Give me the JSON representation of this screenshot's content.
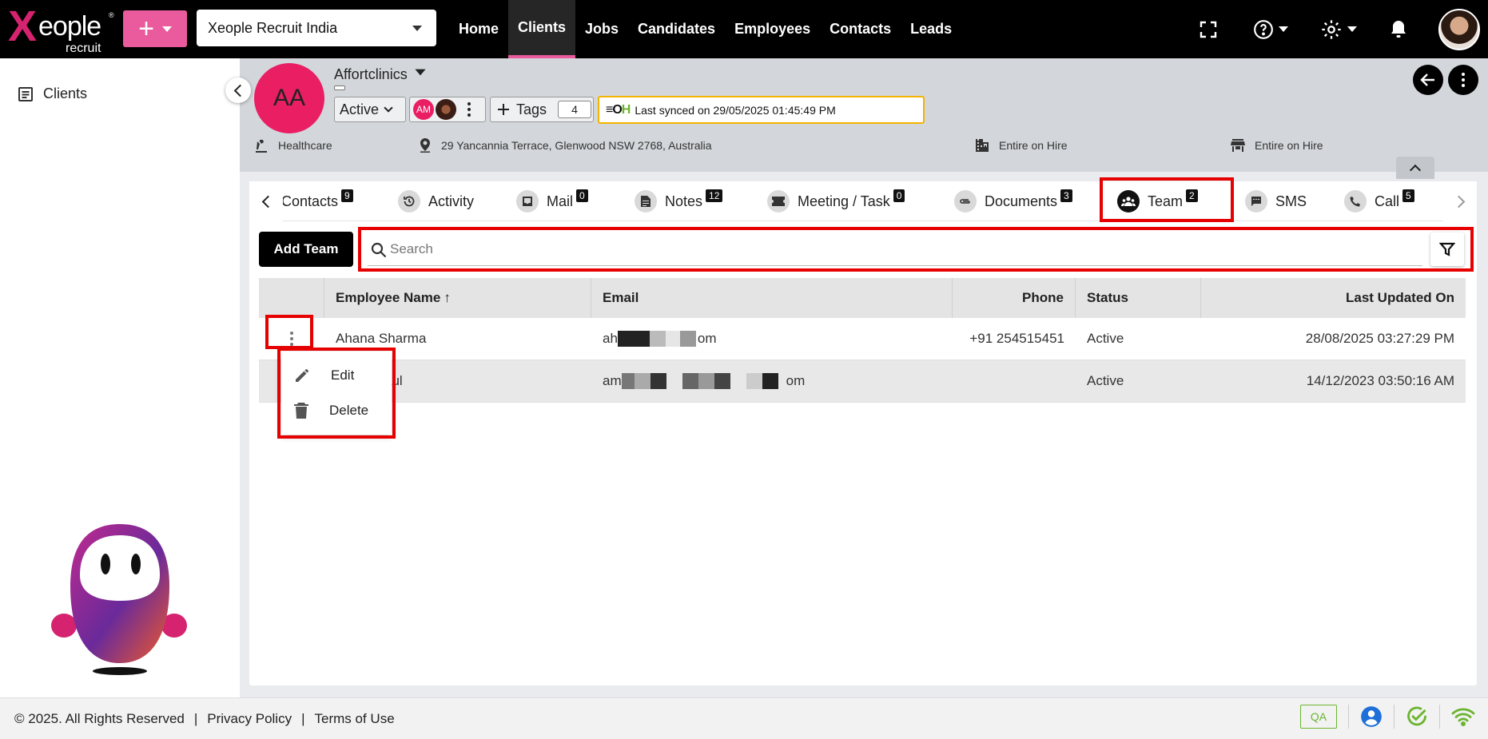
{
  "brand": {
    "logo_x": "X",
    "logo_eople": "eople",
    "logo_reg": "®",
    "logo_sub": "recruit",
    "accent": "#ea5b9e",
    "highlight": "#e60000"
  },
  "topbar": {
    "company": "Xeople Recruit India",
    "nav": [
      {
        "label": "Home",
        "active": false
      },
      {
        "label": "Clients",
        "active": true
      },
      {
        "label": "Jobs",
        "active": false
      },
      {
        "label": "Candidates",
        "active": false
      },
      {
        "label": "Employees",
        "active": false
      },
      {
        "label": "Contacts",
        "active": false
      },
      {
        "label": "Leads",
        "active": false
      }
    ],
    "icons": [
      "fullscreen-icon",
      "help-icon",
      "settings-icon",
      "bell-icon"
    ]
  },
  "sidebar": {
    "items": [
      {
        "label": "Clients",
        "icon": "list-icon"
      }
    ]
  },
  "client": {
    "initials": "AA",
    "name": "Affortclinics",
    "status": "Active",
    "member_initials": "AM",
    "tags_label": "Tags",
    "tags_count": "4",
    "sync_text": "Last synced on 29/05/2025 01:45:49 PM",
    "oh_logo_a": "≡O",
    "oh_logo_b": "H",
    "industry": "Healthcare",
    "address": "29 Yancannia Terrace, Glenwood NSW 2768, Australia",
    "business_type": "Entire on Hire",
    "ownership": "Entire on Hire"
  },
  "tabs": [
    {
      "label": "Contacts",
      "badge": "9",
      "icon": "contacts-icon"
    },
    {
      "label": "Activity",
      "badge": "",
      "icon": "history-icon"
    },
    {
      "label": "Mail",
      "badge": "0",
      "icon": "mail-icon"
    },
    {
      "label": "Notes",
      "badge": "12",
      "icon": "notes-icon"
    },
    {
      "label": "Meeting / Task",
      "badge": "0",
      "icon": "ticket-icon"
    },
    {
      "label": "Documents",
      "badge": "3",
      "icon": "attachment-icon"
    },
    {
      "label": "Team",
      "badge": "2",
      "icon": "team-icon",
      "active": true
    },
    {
      "label": "SMS",
      "badge": "",
      "icon": "sms-icon"
    },
    {
      "label": "Call",
      "badge": "5",
      "icon": "phone-icon"
    }
  ],
  "team": {
    "add_label": "Add Team",
    "search_placeholder": "Search",
    "columns": [
      "Employee Name",
      "Email",
      "Phone",
      "Status",
      "Last Updated On"
    ],
    "sort_arrow": "↑",
    "rows": [
      {
        "name": "Ahana Sharma",
        "email_start": "ah",
        "email_end": "om",
        "phone": "+91 254515451",
        "status": "Active",
        "updated": "28/08/2025 03:27:29 PM"
      },
      {
        "name": "aul",
        "email_start": "am",
        "email_end": "om",
        "phone": "",
        "status": "Active",
        "updated": "14/12/2023 03:50:16 AM"
      }
    ],
    "menu": [
      {
        "label": "Edit",
        "icon": "pencil-icon"
      },
      {
        "label": "Delete",
        "icon": "trash-icon"
      }
    ]
  },
  "footer": {
    "copyright": "© 2025. All Rights Reserved",
    "sep": "|",
    "privacy": "Privacy Policy",
    "terms": "Terms of Use",
    "qa": "QA"
  }
}
